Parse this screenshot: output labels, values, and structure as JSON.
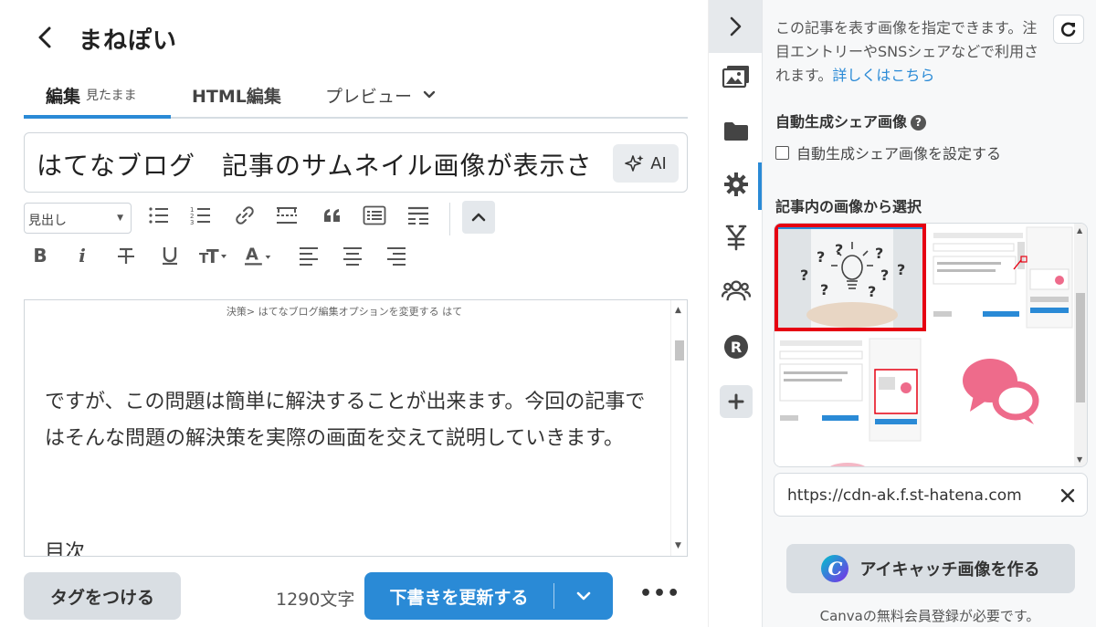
{
  "header": {
    "blog_name": "まねぽい"
  },
  "tabs": {
    "edit_label": "編集",
    "edit_mode": "見たまま",
    "html_label": "HTML編集",
    "preview_label": "プレビュー"
  },
  "editor": {
    "title": "はてなブログ　記事のサムネイル画像が表示さ",
    "ai_label": "AI",
    "heading_select": "見出し",
    "caption": "決策> はてなブログ編集オプションを変更する はて",
    "paragraph": "ですが、この問題は簡単に解決することが出来ます。今回の記事ではそんな問題の解決策を実際の画面を交えて説明していきます。",
    "toc": "目次"
  },
  "footer": {
    "tag_button": "タグをつける",
    "char_count": "1290文字",
    "draft_button": "下書きを更新する",
    "more": "•••"
  },
  "panel": {
    "description": "この記事を表す画像を指定できます。注目エントリーやSNSシェアなどで利用されます。",
    "details_link": "詳しくはこちら",
    "auto_share_title": "自動生成シェア画像",
    "auto_share_checkbox": "自動生成シェア画像を設定する",
    "select_from_article": "記事内の画像から選択",
    "image_url": "https://cdn-ak.f.st-hatena.com",
    "canva_button": "アイキャッチ画像を作る",
    "canva_note": "Canvaの無料会員登録が必要です。"
  },
  "colors": {
    "accent": "#2a8ad6",
    "selected_border": "#e60012",
    "speech_bubble": "#ee6b8b"
  },
  "icons": [
    "chevron-left-icon",
    "sparkle-icon",
    "chevron-right-icon",
    "image-icon",
    "folder-icon",
    "gear-icon",
    "yen-icon",
    "people-icon",
    "r-badge-icon",
    "plus-icon",
    "refresh-icon",
    "help-icon",
    "close-icon",
    "canva-logo-icon"
  ]
}
